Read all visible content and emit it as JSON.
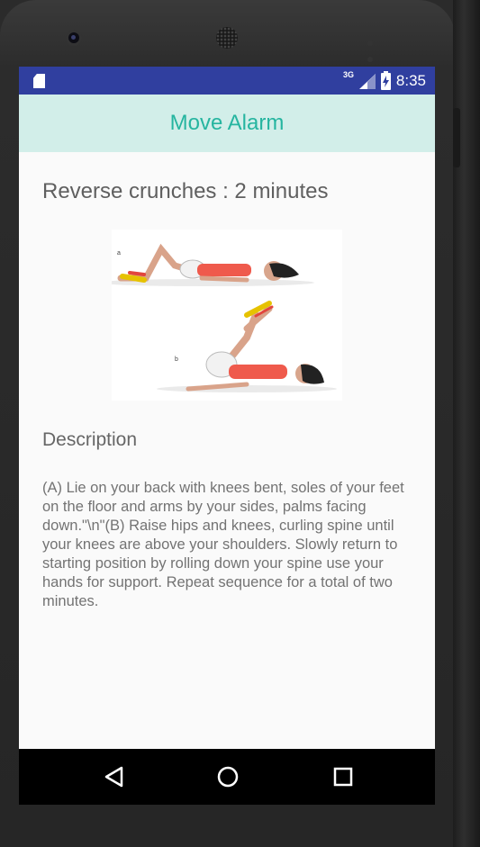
{
  "status_bar": {
    "network_type": "3G",
    "time": "8:35",
    "icons": [
      "sd-card-icon",
      "signal-icon",
      "battery-icon"
    ]
  },
  "app_bar": {
    "title": "Move Alarm"
  },
  "exercise": {
    "title": "Reverse crunches : 2 minutes",
    "image_label_a": "a",
    "image_label_b": "b",
    "description_heading": "Description",
    "description": "(A) Lie on your back with knees bent, soles of your feet on the floor and arms by your sides, palms facing down.\"\\n\"(B) Raise hips and knees, curling spine until your knees are above your shoulders. Slowly return to starting position by rolling down your spine use your hands for support. Repeat sequence for a total of two minutes."
  },
  "nav_bar": {
    "icons": [
      "back-icon",
      "home-icon",
      "recents-icon"
    ]
  },
  "colors": {
    "status_bar": "#303f9f",
    "app_bar": "#d2eee9",
    "title_text": "#26b5a0"
  }
}
